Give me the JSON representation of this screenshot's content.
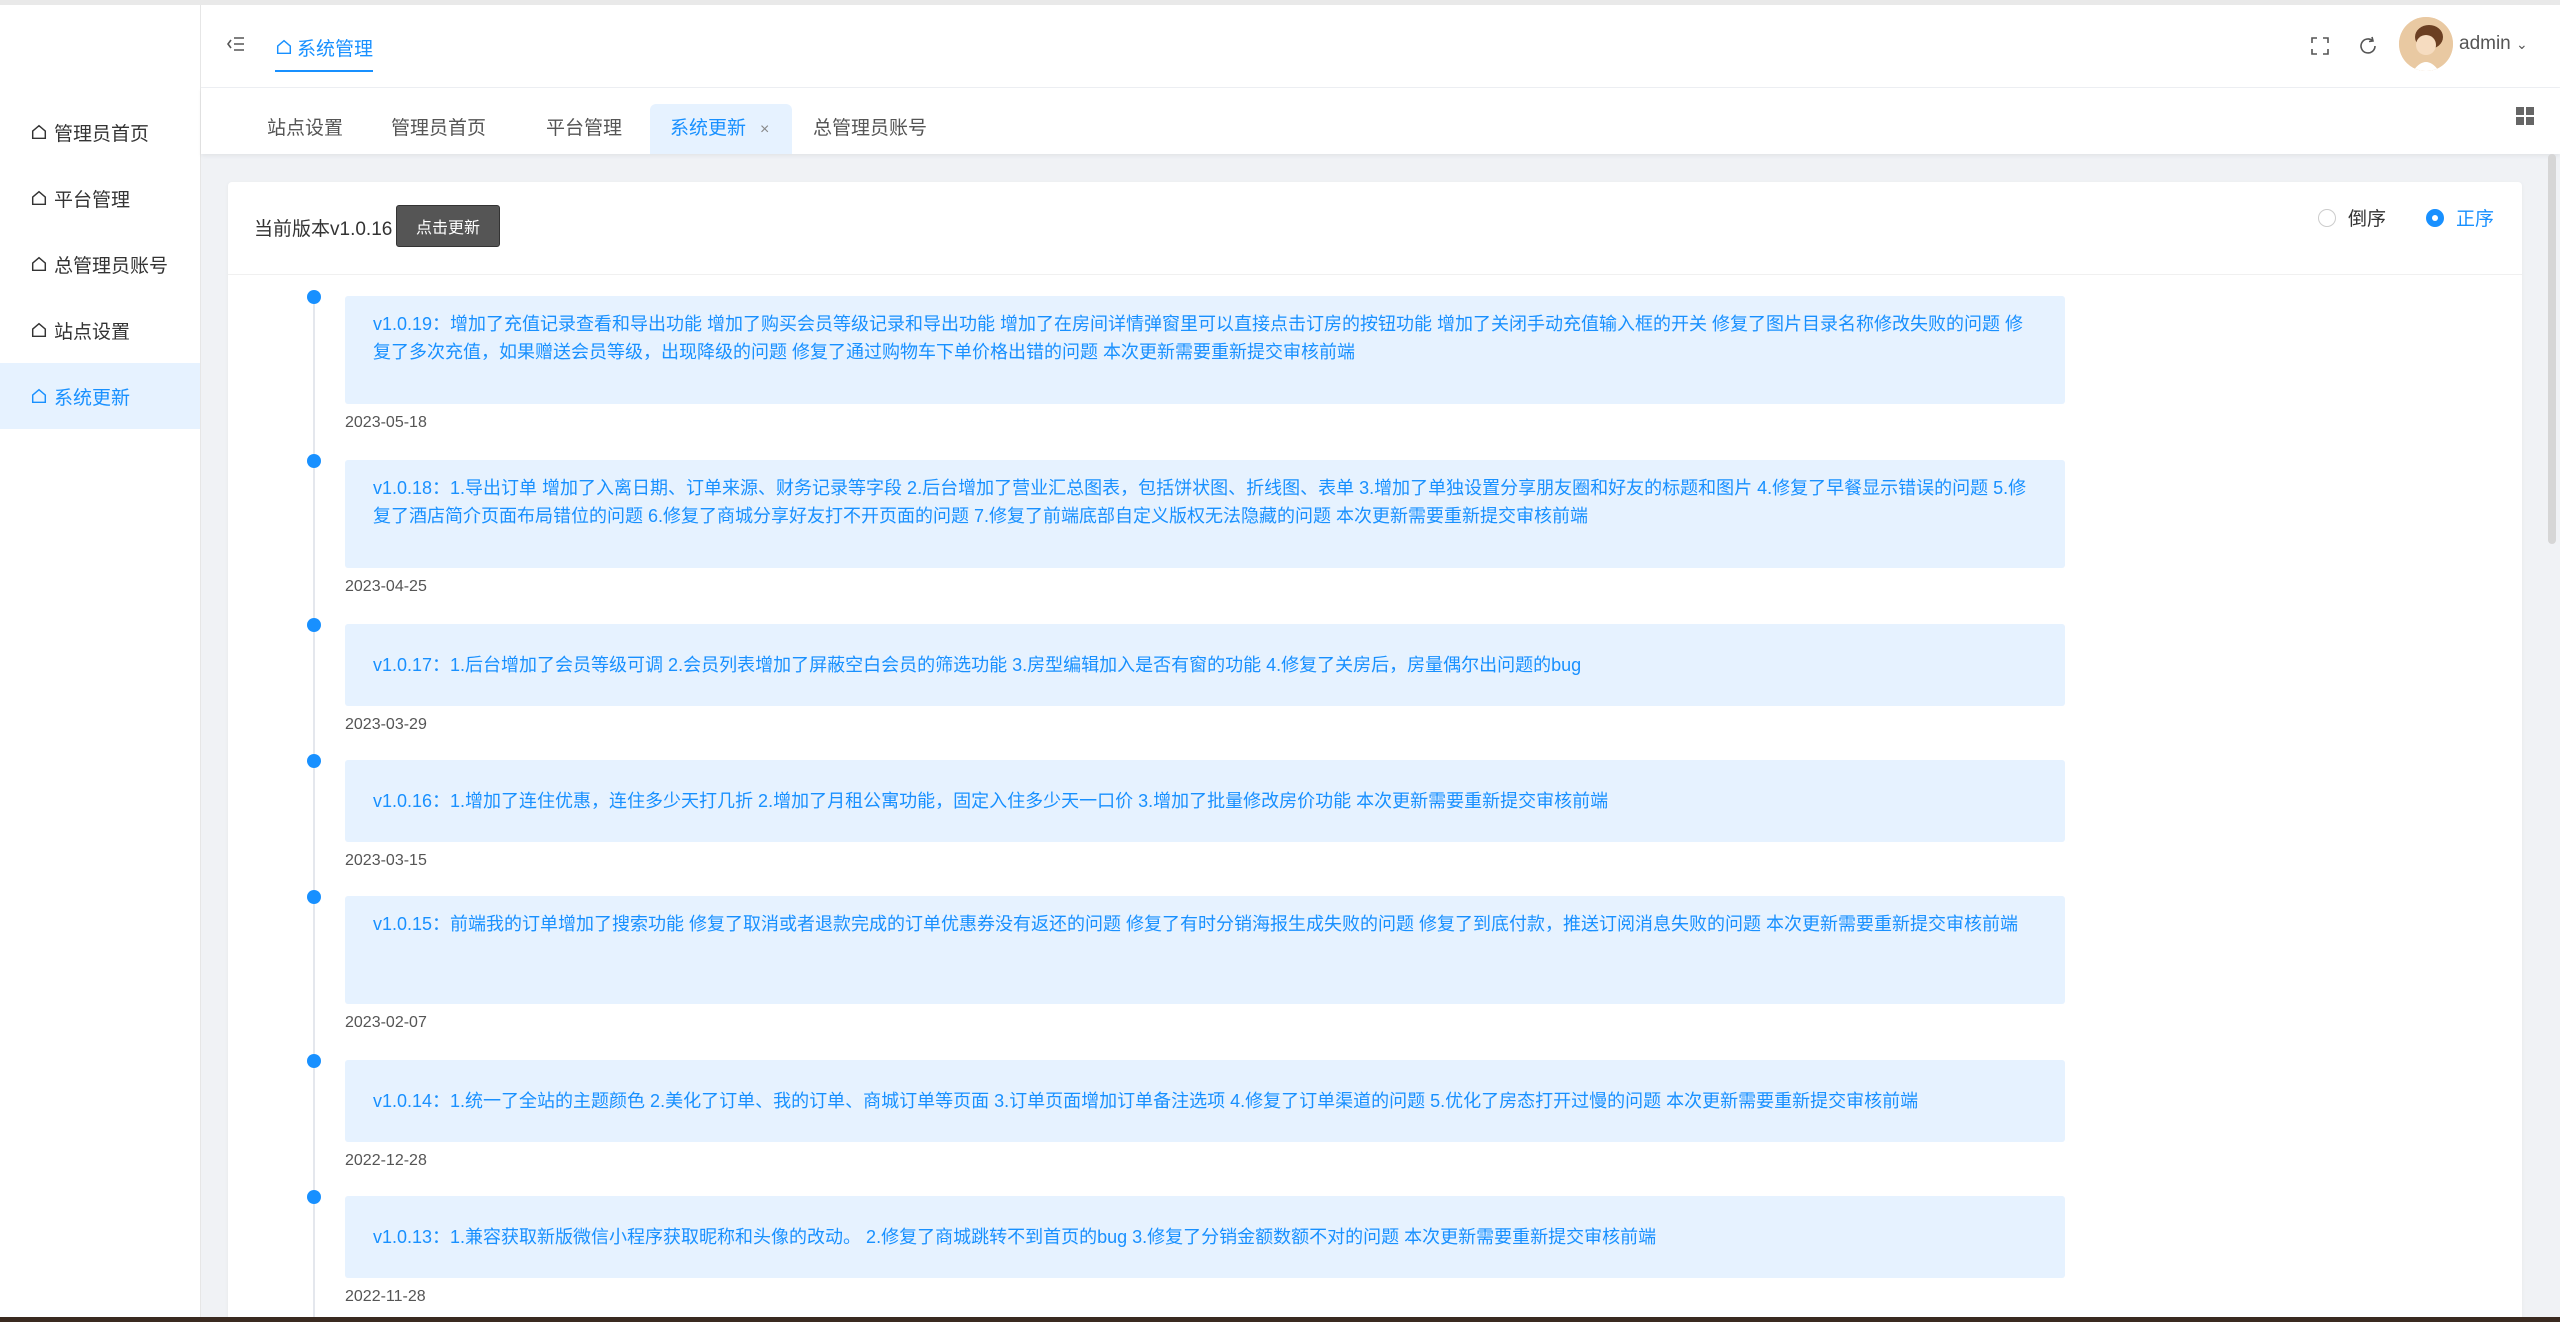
{
  "sidebar": {
    "items": [
      {
        "label": "管理员首页"
      },
      {
        "label": "平台管理"
      },
      {
        "label": "总管理员账号"
      },
      {
        "label": "站点设置"
      },
      {
        "label": "系统更新"
      }
    ],
    "active_index": 4
  },
  "header": {
    "breadcrumb": "系统管理",
    "user": "admin"
  },
  "tabs": [
    {
      "label": "站点设置"
    },
    {
      "label": "管理员首页"
    },
    {
      "label": "平台管理"
    },
    {
      "label": "系统更新",
      "close": "×"
    },
    {
      "label": "总管理员账号"
    }
  ],
  "main": {
    "current_version": "当前版本v1.0.16",
    "update_button": "点击更新",
    "sort": {
      "desc": "倒序",
      "asc": "正序",
      "selected": "正序"
    }
  },
  "timeline": [
    {
      "content": "v1.0.19：增加了充值记录查看和导出功能 增加了购买会员等级记录和导出功能 增加了在房间详情弹窗里可以直接点击订房的按钮功能 增加了关闭手动充值输入框的开关 修复了图片目录名称修改失败的问题 修复了多次充值，如果赠送会员等级，出现降级的问题 修复了通过购物车下单价格出错的问题 本次更新需要重新提交审核前端",
      "date": "2023-05-18"
    },
    {
      "content": "v1.0.18：1.导出订单 增加了入离日期、订单来源、财务记录等字段 2.后台增加了营业汇总图表，包括饼状图、折线图、表单 3.增加了单独设置分享朋友圈和好友的标题和图片 4.修复了早餐显示错误的问题 5.修复了酒店简介页面布局错位的问题 6.修复了商城分享好友打不开页面的问题 7.修复了前端底部自定义版权无法隐藏的问题 本次更新需要重新提交审核前端",
      "date": "2023-04-25"
    },
    {
      "content": "v1.0.17：1.后台增加了会员等级可调 2.会员列表增加了屏蔽空白会员的筛选功能 3.房型编辑加入是否有窗的功能 4.修复了关房后，房量偶尔出问题的bug",
      "date": "2023-03-29"
    },
    {
      "content": "v1.0.16：1.增加了连住优惠，连住多少天打几折 2.增加了月租公寓功能，固定入住多少天一口价 3.增加了批量修改房价功能 本次更新需要重新提交审核前端",
      "date": "2023-03-15"
    },
    {
      "content": "v1.0.15：前端我的订单增加了搜索功能 修复了取消或者退款完成的订单优惠券没有返还的问题 修复了有时分销海报生成失败的问题 修复了到底付款，推送订阅消息失败的问题 本次更新需要重新提交审核前端",
      "date": "2023-02-07"
    },
    {
      "content": "v1.0.14：1.统一了全站的主题颜色 2.美化了订单、我的订单、商城订单等页面 3.订单页面增加订单备注选项 4.修复了订单渠道的问题 5.优化了房态打开过慢的问题 本次更新需要重新提交审核前端",
      "date": "2022-12-28"
    },
    {
      "content": "v1.0.13：1.兼容获取新版微信小程序获取昵称和头像的改动。 2.修复了商城跳转不到首页的bug 3.修复了分销金额数额不对的问题 本次更新需要重新提交审核前端",
      "date": "2022-11-28"
    }
  ],
  "colors": {
    "accent": "#1890ff",
    "accent_bg": "#e6f2ff",
    "button_dark": "#555555"
  },
  "icons": [
    "collapse-icon",
    "home-icon",
    "fullscreen-icon",
    "refresh-icon",
    "chevron-down-icon",
    "grid-icon"
  ]
}
